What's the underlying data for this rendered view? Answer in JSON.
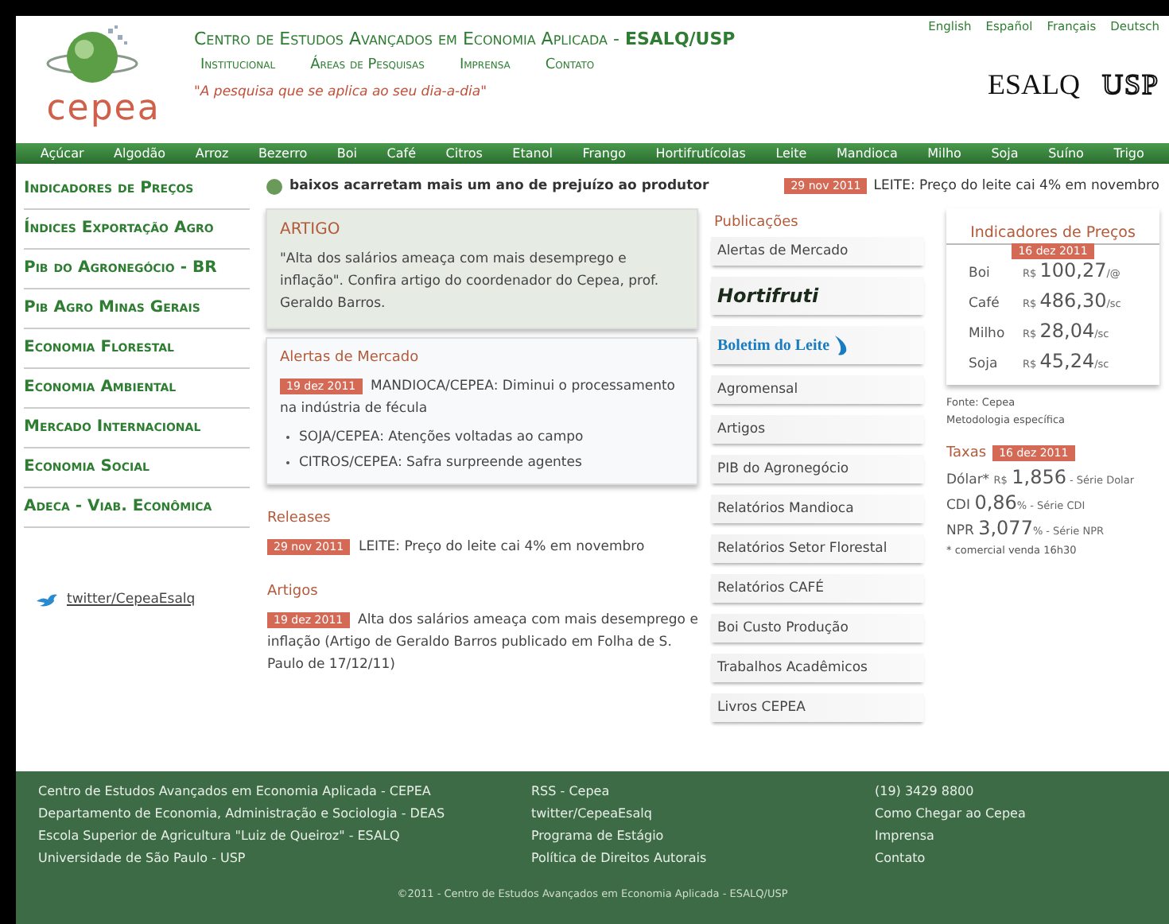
{
  "header": {
    "logo_text": "cepea",
    "title": "Centro de Estudos Avançados em Economia Aplicada - **ESALQ/USP**",
    "menu": [
      "Institucional",
      "Áreas de Pesquisas",
      "Imprensa",
      "Contato"
    ],
    "tagline": "\"A pesquisa que se aplica ao seu dia-a-dia\"",
    "languages": [
      "English",
      "Español",
      "Français",
      "Deutsch"
    ],
    "partner_logos": [
      "ESALQ",
      "USP"
    ]
  },
  "nav": [
    "Açúcar",
    "Algodão",
    "Arroz",
    "Bezerro",
    "Boi",
    "Café",
    "Citros",
    "Etanol",
    "Frango",
    "Hortifrutícolas",
    "Leite",
    "Mandioca",
    "Milho",
    "Soja",
    "Suíno",
    "Trigo"
  ],
  "ticker": {
    "text": "baixos acarretam mais um ano de prejuízo ao produtor",
    "date": "29 nov 2011",
    "headline": "LEITE: Preço do leite cai 4% em novembro"
  },
  "sidebar": {
    "items": [
      "Indicadores de Preços",
      "Índices Exportação Agro",
      "Pib do Agronegócio - BR",
      "Pib Agro Minas Gerais",
      "Economia Florestal",
      "Economia Ambiental",
      "Mercado Internacional",
      "Economia Social",
      "Adeca - Viab. Econômica"
    ],
    "twitter": "twitter/CepeaEsalq"
  },
  "artigo": {
    "title": "ARTIGO",
    "text": "\"Alta dos salários ameaça com mais desemprego e inflação\". Confira artigo do coordenador do Cepea, prof. Geraldo Barros."
  },
  "alertas": {
    "title": "Alertas de Mercado",
    "date": "19 dez 2011",
    "headline": "MANDIOCA/CEPEA: Diminui o processamento na indústria de fécula",
    "items": [
      "SOJA/CEPEA: Atenções voltadas ao campo",
      "CITROS/CEPEA: Safra surpreende agentes"
    ]
  },
  "releases": {
    "title": "Releases",
    "date": "29 nov 2011",
    "text": "LEITE: Preço do leite cai 4% em novembro"
  },
  "artigos": {
    "title": "Artigos",
    "date": "19 dez 2011",
    "text": "Alta dos salários ameaça com mais desemprego e inflação (Artigo de Geraldo Barros publicado em Folha de S. Paulo de 17/12/11)"
  },
  "publicacoes": {
    "title": "Publicações",
    "items": [
      {
        "kind": "text",
        "label": "Alertas de Mercado"
      },
      {
        "kind": "hortifruti",
        "label": "Hortifruti"
      },
      {
        "kind": "leite",
        "label": "Boletim do Leite"
      },
      {
        "kind": "text",
        "label": "Agromensal"
      },
      {
        "kind": "text",
        "label": "Artigos"
      },
      {
        "kind": "text",
        "label": "PIB do Agronegócio"
      },
      {
        "kind": "text",
        "label": "Relatórios Mandioca"
      },
      {
        "kind": "text",
        "label": "Relatórios Setor Florestal"
      },
      {
        "kind": "text",
        "label": "Relatórios CAFÉ"
      },
      {
        "kind": "text",
        "label": "Boi Custo Produção"
      },
      {
        "kind": "text",
        "label": "Trabalhos Acadêmicos"
      },
      {
        "kind": "text",
        "label": "Livros CEPEA"
      }
    ]
  },
  "indicadores": {
    "title": "Indicadores de Preços",
    "date": "16 dez 2011",
    "rows": [
      {
        "name": "Boi",
        "currency": "R$",
        "value": "100,27",
        "unit": "/@"
      },
      {
        "name": "Café",
        "currency": "R$",
        "value": "486,30",
        "unit": "/sc"
      },
      {
        "name": "Milho",
        "currency": "R$",
        "value": "28,04",
        "unit": "/sc"
      },
      {
        "name": "Soja",
        "currency": "R$",
        "value": "45,24",
        "unit": "/sc"
      }
    ],
    "source": "Fonte: Cepea",
    "method": "Metodologia específica"
  },
  "taxas": {
    "title": "Taxas",
    "date": "16 dez 2011",
    "rows": [
      {
        "name": "Dólar*",
        "currency": "R$",
        "value": "1,856",
        "unit": "",
        "link": "- Série Dolar"
      },
      {
        "name": "CDI",
        "currency": "",
        "value": "0,86",
        "unit": "%",
        "link": "- Série CDI"
      },
      {
        "name": "NPR",
        "currency": "",
        "value": "3,077",
        "unit": "%",
        "link": "- Série NPR"
      }
    ],
    "note": "* comercial venda 16h30"
  },
  "footer": {
    "columns": [
      [
        "Centro de Estudos Avançados em Economia Aplicada - CEPEA",
        "Departamento de Economia, Administração e Sociologia - DEAS",
        "Escola Superior de Agricultura \"Luiz de Queiroz\" - ESALQ",
        "Universidade de São Paulo - USP"
      ],
      [
        "RSS - Cepea",
        "twitter/CepeaEsalq",
        "Programa de Estágio",
        "Política de Direitos Autorais"
      ],
      [
        "(19) 3429 8800",
        "Como Chegar ao Cepea",
        "Imprensa",
        "Contato"
      ]
    ],
    "copyright": "©2011 - Centro de Estudos Avançados em Economia Aplicada - ESALQ/USP"
  }
}
